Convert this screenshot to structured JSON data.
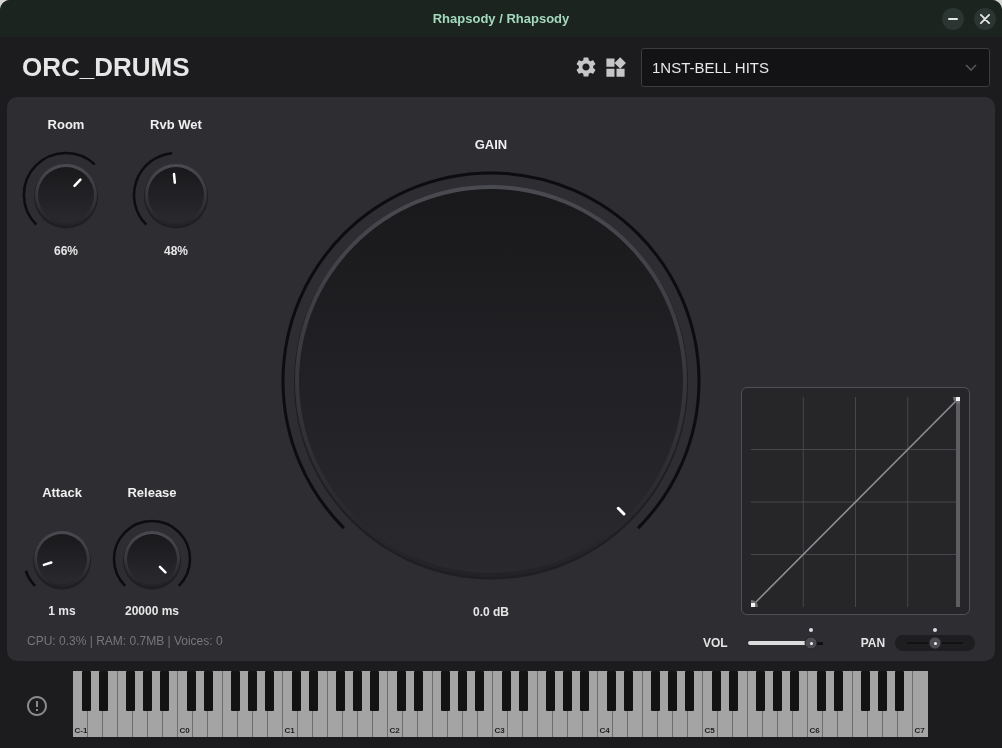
{
  "window": {
    "title": "Rhapsody / Rhapsody"
  },
  "header": {
    "instrument": "ORC_DRUMS",
    "preset_dropdown": {
      "value": "1NST-BELL HITS"
    }
  },
  "left_panel": {
    "reverb_knobs": [
      {
        "label": "Room",
        "value": "66%",
        "level": 0.66
      },
      {
        "label": "Rvb Wet",
        "value": "48%",
        "level": 0.48
      }
    ],
    "envelope_knobs": [
      {
        "label": "Attack",
        "value": "1 ms",
        "level": 0.1
      },
      {
        "label": "Release",
        "value": "20000 ms",
        "level": 1
      }
    ],
    "status": "CPU: 0.3% | RAM: 0.7MB | Voices: 0"
  },
  "gain_knob": {
    "label": "GAIN",
    "value": "0.0 dB",
    "level": 1
  },
  "sliders": [
    {
      "kind": "fill",
      "label": "VOL",
      "level": 0.85
    },
    {
      "kind": "centered",
      "label": "PAN",
      "level": 0.5
    }
  ],
  "keyboard": {
    "octave_labels": [
      "C-1",
      "C0",
      "C1",
      "C2",
      "C3",
      "C4",
      "C5",
      "C6",
      "C7"
    ]
  }
}
